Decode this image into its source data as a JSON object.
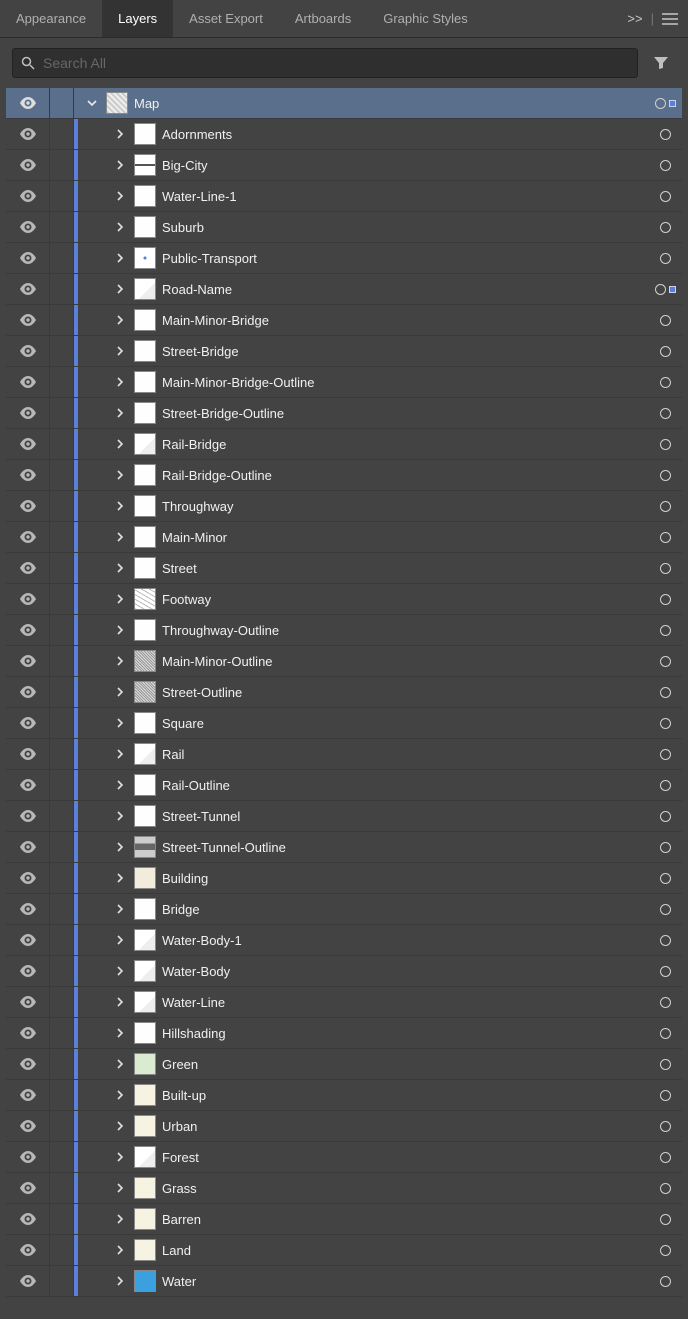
{
  "tabs": {
    "items": [
      "Appearance",
      "Layers",
      "Asset Export",
      "Artboards",
      "Graphic Styles"
    ],
    "active_index": 1,
    "overflow_glyph": ">>",
    "sep_glyph": "|"
  },
  "search": {
    "placeholder": "Search All",
    "value": ""
  },
  "layers": {
    "parent": {
      "name": "Map",
      "has_children": true,
      "selection_marker": true,
      "thumb_class": "th-map"
    },
    "children": [
      {
        "name": "Adornments",
        "thumb": "th-white",
        "marker": false
      },
      {
        "name": "Big-City",
        "thumb": "th-lines",
        "marker": false
      },
      {
        "name": "Water-Line-1",
        "thumb": "th-white",
        "marker": false
      },
      {
        "name": "Suburb",
        "thumb": "th-white",
        "marker": false
      },
      {
        "name": "Public-Transport",
        "thumb": "th-dot",
        "marker": false
      },
      {
        "name": "Road-Name",
        "thumb": "th-faint",
        "marker": true
      },
      {
        "name": "Main-Minor-Bridge",
        "thumb": "th-white",
        "marker": false
      },
      {
        "name": "Street-Bridge",
        "thumb": "th-white",
        "marker": false
      },
      {
        "name": "Main-Minor-Bridge-Outline",
        "thumb": "th-white",
        "marker": false
      },
      {
        "name": "Street-Bridge-Outline",
        "thumb": "th-white",
        "marker": false
      },
      {
        "name": "Rail-Bridge",
        "thumb": "th-faint",
        "marker": false
      },
      {
        "name": "Rail-Bridge-Outline",
        "thumb": "th-white",
        "marker": false
      },
      {
        "name": "Throughway",
        "thumb": "th-white",
        "marker": false
      },
      {
        "name": "Main-Minor",
        "thumb": "th-white",
        "marker": false
      },
      {
        "name": "Street",
        "thumb": "th-white",
        "marker": false
      },
      {
        "name": "Footway",
        "thumb": "th-scribble",
        "marker": false
      },
      {
        "name": "Throughway-Outline",
        "thumb": "th-white",
        "marker": false
      },
      {
        "name": "Main-Minor-Outline",
        "thumb": "th-dense",
        "marker": false
      },
      {
        "name": "Street-Outline",
        "thumb": "th-dense",
        "marker": false
      },
      {
        "name": "Square",
        "thumb": "th-white",
        "marker": false
      },
      {
        "name": "Rail",
        "thumb": "th-faint",
        "marker": false
      },
      {
        "name": "Rail-Outline",
        "thumb": "th-white",
        "marker": false
      },
      {
        "name": "Street-Tunnel",
        "thumb": "th-white",
        "marker": false
      },
      {
        "name": "Street-Tunnel-Outline",
        "thumb": "th-stripe",
        "marker": false
      },
      {
        "name": "Building",
        "thumb": "th-beige",
        "marker": false
      },
      {
        "name": "Bridge",
        "thumb": "th-white",
        "marker": false
      },
      {
        "name": "Water-Body-1",
        "thumb": "th-faint",
        "marker": false
      },
      {
        "name": "Water-Body",
        "thumb": "th-faint",
        "marker": false
      },
      {
        "name": "Water-Line",
        "thumb": "th-faint",
        "marker": false
      },
      {
        "name": "Hillshading",
        "thumb": "th-white",
        "marker": false
      },
      {
        "name": "Green",
        "thumb": "th-green",
        "marker": false
      },
      {
        "name": "Built-up",
        "thumb": "th-cream",
        "marker": false
      },
      {
        "name": "Urban",
        "thumb": "th-cream",
        "marker": false
      },
      {
        "name": "Forest",
        "thumb": "th-faint",
        "marker": false
      },
      {
        "name": "Grass",
        "thumb": "th-cream",
        "marker": false
      },
      {
        "name": "Barren",
        "thumb": "th-cream",
        "marker": false
      },
      {
        "name": "Land",
        "thumb": "th-cream",
        "marker": false
      },
      {
        "name": "Water",
        "thumb": "th-blue",
        "marker": false
      }
    ]
  }
}
